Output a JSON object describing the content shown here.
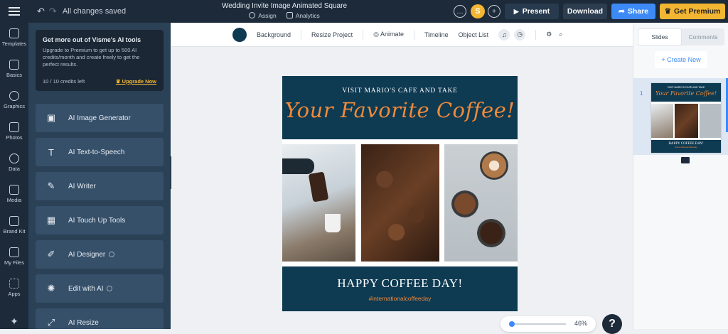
{
  "header": {
    "saved_status": "All changes saved",
    "doc_title": "Wedding Invite Image Animated Square",
    "assign_label": "Assign",
    "analytics_label": "Analytics",
    "avatar_initial": "S",
    "present_label": "Present",
    "download_label": "Download",
    "share_label": "Share",
    "premium_label": "Get Premium"
  },
  "rail": {
    "items": [
      {
        "label": "Templates"
      },
      {
        "label": "Basics"
      },
      {
        "label": "Graphics"
      },
      {
        "label": "Photos"
      },
      {
        "label": "Data"
      },
      {
        "label": "Media"
      },
      {
        "label": "Brand Kit"
      },
      {
        "label": "My Files"
      },
      {
        "label": "Apps"
      }
    ]
  },
  "ai_panel": {
    "promo_title": "Get more out of Visme's AI tools",
    "promo_text": "Upgrade to Premium to get up to 500 AI credits/month and create freely to get the perfect results.",
    "credits": "10 / 10 credits left",
    "upgrade_label": "Upgrade Now",
    "items": [
      {
        "label": "AI Image Generator"
      },
      {
        "label": "AI Text-to-Speech"
      },
      {
        "label": "AI Writer"
      },
      {
        "label": "AI Touch Up Tools"
      },
      {
        "label": "AI Designer"
      },
      {
        "label": "Edit with AI"
      },
      {
        "label": "AI Resize"
      }
    ]
  },
  "toolbar": {
    "background_label": "Background",
    "resize_label": "Resize Project",
    "animate_label": "Animate",
    "timeline_label": "Timeline",
    "object_list_label": "Object List",
    "background_color": "#0e3a52"
  },
  "design": {
    "pre_title": "VISIT MARIO'S CAFE AND TAKE",
    "script_title": "Your Favorite Coffee!",
    "footer_title": "HAPPY COFFEE DAY!",
    "hashtag": "#internationalcoffeeday"
  },
  "zoom": {
    "level": "46%"
  },
  "help": {
    "label": "?"
  },
  "right_panel": {
    "tab_slides": "Slides",
    "tab_comments": "Comments",
    "create_new_label": "+ Create New",
    "slide_number": "1",
    "thumb": {
      "pre_title": "VISIT MARIO'S CAFE AND TAKE",
      "script_title": "Your Favorite Coffee!",
      "footer_title": "HAPPY COFFEE DAY!",
      "hashtag": "#internationalcoffeeday"
    }
  },
  "colors": {
    "brand_navy": "#0e3a52",
    "accent_orange": "#ee8a3a",
    "premium_gold": "#f2b632",
    "share_blue": "#3d8af7"
  }
}
